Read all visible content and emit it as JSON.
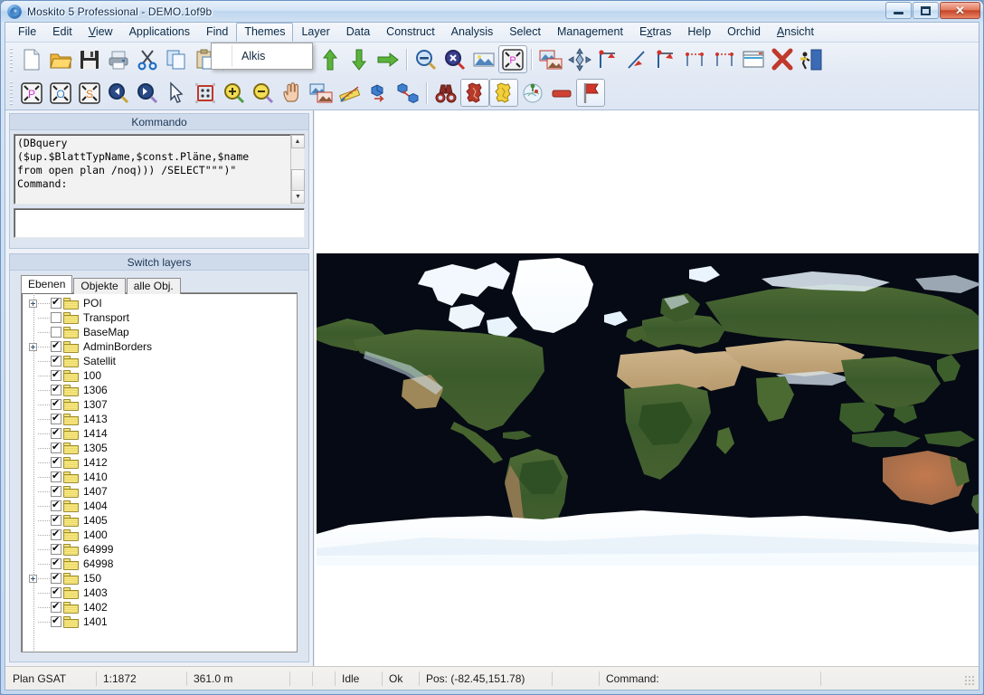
{
  "window": {
    "title": "Moskito 5 Professional - DEMO.1of9b",
    "icon": "globe-icon",
    "buttons": {
      "minimize": "minimize",
      "maximize": "maximize",
      "close": "✕"
    }
  },
  "menubar": {
    "items": [
      {
        "label": "File",
        "mnemonic": "",
        "active": false
      },
      {
        "label": "Edit",
        "mnemonic": "",
        "active": false
      },
      {
        "label": "View",
        "mnemonic": "V",
        "active": false
      },
      {
        "label": "Applications",
        "mnemonic": "",
        "active": false
      },
      {
        "label": "Find",
        "mnemonic": "",
        "active": false
      },
      {
        "label": "Themes",
        "mnemonic": "",
        "active": true
      },
      {
        "label": "Layer",
        "mnemonic": "",
        "active": false
      },
      {
        "label": "Data",
        "mnemonic": "",
        "active": false
      },
      {
        "label": "Construct",
        "mnemonic": "",
        "active": false
      },
      {
        "label": "Analysis",
        "mnemonic": "",
        "active": false
      },
      {
        "label": "Select",
        "mnemonic": "",
        "active": false
      },
      {
        "label": "Management",
        "mnemonic": "",
        "active": false
      },
      {
        "label": "Extras",
        "mnemonic": "x",
        "active": false
      },
      {
        "label": "Help",
        "mnemonic": "",
        "active": false
      },
      {
        "label": "Orchid",
        "mnemonic": "",
        "active": false
      },
      {
        "label": "Ansicht",
        "mnemonic": "A",
        "active": false
      }
    ]
  },
  "themes_menu": {
    "open": true,
    "items": [
      {
        "label": "Alkis"
      }
    ]
  },
  "toolbar_row1": {
    "icons": [
      "new-document-icon",
      "open-folder-icon",
      "save-floppy-icon",
      "print-icon",
      "cut-scissors-icon",
      "copy-icon",
      "paste-icon",
      "redo-arrow-icon",
      "refresh-icon",
      "arrow-left-icon",
      "arrow-up-icon",
      "arrow-down-icon",
      "arrow-right-icon",
      "zoom-out-icon",
      "zoom-all-icon",
      "image-icon",
      "zoom-plan-extent-icon",
      "image-overlay-icon",
      "snap-icon",
      "measure-line-icon",
      "measure-diagonal-icon",
      "measure-angle-icon",
      "dim-horizontal-icon",
      "dim-vertical-icon",
      "window-icon",
      "delete-x-icon",
      "exit-icon"
    ]
  },
  "toolbar_row2": {
    "icons": [
      "zoom-plan-icon",
      "zoom-object-icon",
      "zoom-selection-icon",
      "zoom-previous-icon",
      "zoom-next-icon",
      "select-arrow-icon",
      "select-rectangle-icon",
      "zoom-in-magnifier-icon",
      "zoom-out-magnifier-icon",
      "pan-hand-icon",
      "raster-overlay-icon",
      "ruler-icon",
      "move-3d-icon",
      "copy-3d-icon",
      "binoculars-icon",
      "germany-red-icon",
      "germany-yellow-icon",
      "globe-pin-icon",
      "red-bar-icon",
      "red-flag-icon"
    ]
  },
  "kommando": {
    "header": "Kommando",
    "log": "(DBquery\n($up.$BlattTypName,$const.Pläne,$name\nfrom open plan /noq))) /SELECT\"\"\")\"\nCommand:",
    "input_value": "",
    "scroll_up": "▲",
    "scroll_down": "▼"
  },
  "switch_layers": {
    "header": "Switch layers",
    "tabs": [
      {
        "label": "Ebenen",
        "selected": true
      },
      {
        "label": "Objekte",
        "selected": false
      },
      {
        "label": "alle Obj.",
        "selected": false
      }
    ],
    "tree": [
      {
        "label": "POI",
        "checked": true,
        "expandable": true
      },
      {
        "label": "Transport",
        "checked": false,
        "expandable": false
      },
      {
        "label": "BaseMap",
        "checked": false,
        "expandable": false
      },
      {
        "label": "AdminBorders",
        "checked": true,
        "expandable": true
      },
      {
        "label": "Satellit",
        "checked": true,
        "expandable": false
      },
      {
        "label": "100",
        "checked": true,
        "expandable": false
      },
      {
        "label": "1306",
        "checked": true,
        "expandable": false
      },
      {
        "label": "1307",
        "checked": true,
        "expandable": false
      },
      {
        "label": "1413",
        "checked": true,
        "expandable": false
      },
      {
        "label": "1414",
        "checked": true,
        "expandable": false
      },
      {
        "label": "1305",
        "checked": true,
        "expandable": false
      },
      {
        "label": "1412",
        "checked": true,
        "expandable": false
      },
      {
        "label": "1410",
        "checked": true,
        "expandable": false
      },
      {
        "label": "1407",
        "checked": true,
        "expandable": false
      },
      {
        "label": "1404",
        "checked": true,
        "expandable": false
      },
      {
        "label": "1405",
        "checked": true,
        "expandable": false
      },
      {
        "label": "1400",
        "checked": true,
        "expandable": false
      },
      {
        "label": "64999",
        "checked": true,
        "expandable": false
      },
      {
        "label": "64998",
        "checked": true,
        "expandable": false
      },
      {
        "label": "150",
        "checked": true,
        "expandable": true
      },
      {
        "label": "1403",
        "checked": true,
        "expandable": false
      },
      {
        "label": "1402",
        "checked": true,
        "expandable": false
      },
      {
        "label": "1401",
        "checked": true,
        "expandable": false
      }
    ]
  },
  "map": {
    "name": "satellite-world-map",
    "background_color": "#050a14",
    "canvas_color": "#ffffff"
  },
  "statusbar": {
    "plan": "Plan GSAT",
    "scale": "1:1872",
    "distance": "361.0 m",
    "blank1": "",
    "blank2": "",
    "state": "Idle",
    "status": "Ok",
    "position": "Pos: (-82.45,151.78)",
    "blank3": "",
    "command": "Command:",
    "blank4": ""
  }
}
